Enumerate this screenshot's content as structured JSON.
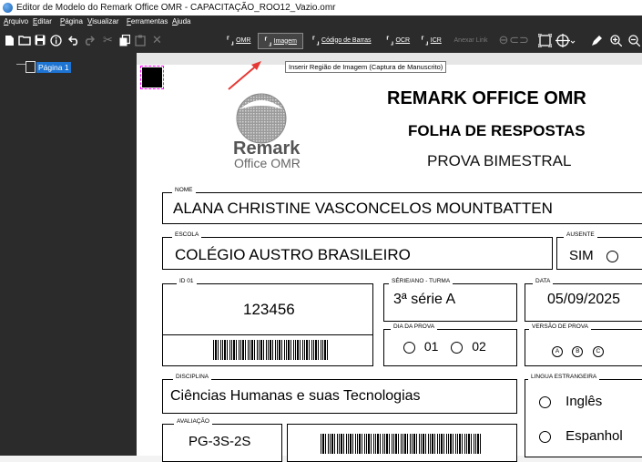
{
  "window": {
    "title": "Editor de Modelo do Remark Office OMR - CAPACITAÇÃO_ROO12_Vazio.omr"
  },
  "menu": [
    "Arquivo",
    "Editar",
    "Página",
    "Visualizar",
    "Ferramentas",
    "Ajuda"
  ],
  "toolbar": {
    "omr_label": "OMR",
    "imagem_label": "Imagem",
    "codigo_label": "Código de Barras",
    "ocr_label": "OCR",
    "icr_label": "ICR",
    "anexar_label": "Anexar Link",
    "tooltip": "Inserir Região de Imagem (Captura de Manuscrito)"
  },
  "tree": {
    "page_label": "Página 1"
  },
  "form": {
    "logo_line1": "Remark",
    "logo_line2": "Office OMR",
    "header1": "REMARK OFFICE OMR",
    "header2": "FOLHA DE RESPOSTAS",
    "header3": "PROVA BIMESTRAL",
    "nome_caption": "NOME",
    "nome_value": "ALANA CHRISTINE VASCONCELOS MOUNTBATTEN",
    "escola_caption": "ESCOLA",
    "escola_value": "COLÉGIO AUSTRO BRASILEIRO",
    "ausente_caption": "AUSENTE",
    "ausente_value": "SIM",
    "id_caption": "ID 01",
    "id_value": "123456",
    "serie_caption": "SÉRIE/ANO - TURMA",
    "serie_value": "3ª série A",
    "data_caption": "DATA",
    "data_value": "05/09/2025",
    "dia_caption": "DIA DA PROVA",
    "dia_opt1": "01",
    "dia_opt2": "02",
    "versao_caption": "VERSÃO DE PROVA",
    "versao_a": "A",
    "versao_b": "B",
    "versao_c": "C",
    "disciplina_caption": "DISCIPLINA",
    "disciplina_value": "Ciências Humanas e suas Tecnologias",
    "lingua_caption": "LINGUA ESTRANGEIRA",
    "lingua_opt1": "Inglês",
    "lingua_opt2": "Espanhol",
    "avaliacao_caption": "AVALIAÇÃO",
    "avaliacao_value": "PG-3S-2S"
  },
  "colors": {
    "chrome": "#2b2b2b",
    "selection": "#1e74d2",
    "marker": "#ff00ff",
    "arrow": "#e53935"
  }
}
